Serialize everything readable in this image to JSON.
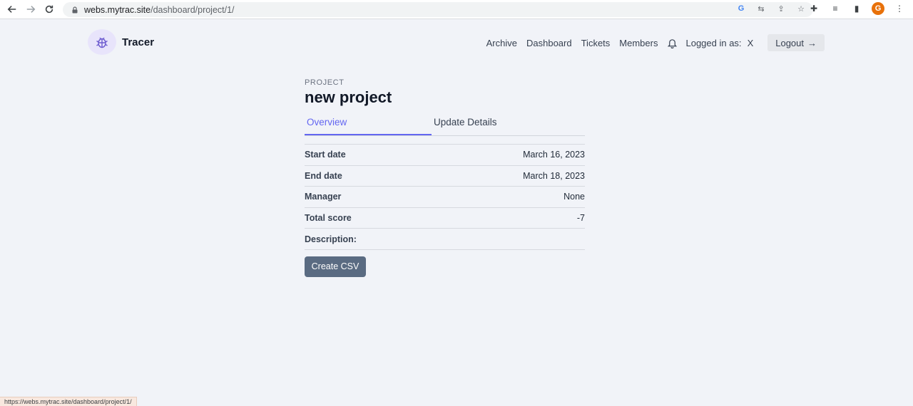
{
  "browser": {
    "url_host": "webs.mytrac.site",
    "url_path": "/dashboard/project/1/",
    "profile_initial": "G",
    "status_url": "https://webs.mytrac.site/dashboard/project/1/"
  },
  "header": {
    "brand": "Tracer",
    "nav": [
      "Archive",
      "Dashboard",
      "Tickets",
      "Members"
    ],
    "logged_in_label": "Logged in as:",
    "username": "X",
    "logout_label": "Logout"
  },
  "project": {
    "eyebrow": "PROJECT",
    "title": "new project",
    "tabs": [
      {
        "label": "Overview",
        "active": true
      },
      {
        "label": "Update Details",
        "active": false
      }
    ],
    "details": [
      {
        "label": "Start date",
        "value": "March 16, 2023"
      },
      {
        "label": "End date",
        "value": "March 18, 2023"
      },
      {
        "label": "Manager",
        "value": "None"
      },
      {
        "label": "Total score",
        "value": "-7"
      },
      {
        "label": "Description:",
        "value": ""
      }
    ],
    "csv_button": "Create CSV"
  },
  "colors": {
    "accent": "#6366f1",
    "background": "#f1f3f8",
    "button": "#5a6b82"
  }
}
